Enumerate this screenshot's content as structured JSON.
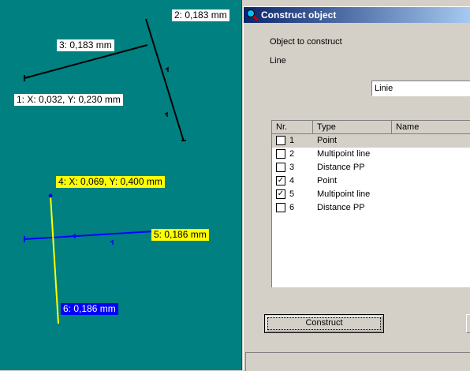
{
  "canvas": {
    "bg": "#008080",
    "labels": {
      "l1": "1: X: 0,032, Y: 0,230 mm",
      "l2": "2: 0,183 mm",
      "l3": "3: 0,183 mm",
      "l4": "4: X: 0,069, Y: 0,400 mm",
      "l5": "5: 0,186 mm",
      "l6": "6: 0,186 mm"
    }
  },
  "dialog": {
    "title": "Construct object",
    "object_label": "Object to construct",
    "object_value": "Line",
    "combo_value": "Linie",
    "columns": [
      "Nr.",
      "Type",
      "Name"
    ],
    "rows": [
      {
        "nr": "1",
        "type": "Point",
        "checked": false,
        "selected": true
      },
      {
        "nr": "2",
        "type": "Multipoint line",
        "checked": false,
        "selected": false
      },
      {
        "nr": "3",
        "type": "Distance PP",
        "checked": false,
        "selected": false
      },
      {
        "nr": "4",
        "type": "Point",
        "checked": true,
        "selected": false
      },
      {
        "nr": "5",
        "type": "Multipoint line",
        "checked": true,
        "selected": false
      },
      {
        "nr": "6",
        "type": "Distance PP",
        "checked": false,
        "selected": false
      }
    ],
    "construct_label": "Construct"
  },
  "colors": {
    "titlebar": "#0a246a",
    "label_yellow": "#ffff00",
    "label_blue": "#0000ff"
  }
}
